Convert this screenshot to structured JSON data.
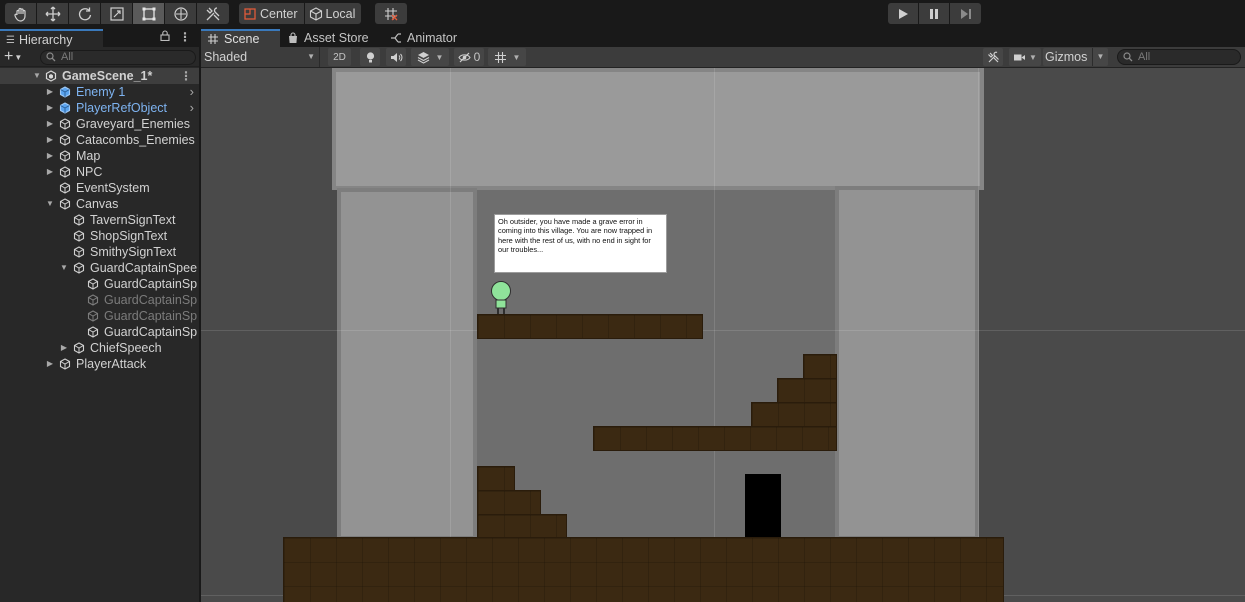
{
  "toolbar": {
    "tools": [
      {
        "name": "hand-tool",
        "icon": "hand-icon"
      },
      {
        "name": "move-tool",
        "icon": "move-arrows-icon"
      },
      {
        "name": "rotate-tool",
        "icon": "rotate-icon"
      },
      {
        "name": "scale-tool",
        "icon": "scale-icon"
      },
      {
        "name": "rect-tool",
        "icon": "rect-transform-icon",
        "active": true
      },
      {
        "name": "transform-tool",
        "icon": "transform-icon"
      },
      {
        "name": "custom-tool",
        "icon": "tools-icon"
      }
    ],
    "pivot_label": "Center",
    "pivot_rotation_label": "Local",
    "grid_snap_icon": "grid-snap-icon",
    "play_controls": [
      "play-icon",
      "pause-icon",
      "step-icon"
    ]
  },
  "hierarchy": {
    "tab_label": "Hierarchy",
    "search_placeholder": "All",
    "scene_name": "GameScene_1*",
    "items": [
      {
        "label": "Enemy 1",
        "depth": 1,
        "expand": "collapsed",
        "prefab": true,
        "chevron": true
      },
      {
        "label": "PlayerRefObject",
        "depth": 1,
        "expand": "collapsed",
        "prefab": true,
        "chevron": true
      },
      {
        "label": "Graveyard_Enemies",
        "depth": 1,
        "expand": "collapsed"
      },
      {
        "label": "Catacombs_Enemies",
        "depth": 1,
        "expand": "collapsed"
      },
      {
        "label": "Map",
        "depth": 1,
        "expand": "collapsed"
      },
      {
        "label": "NPC",
        "depth": 1,
        "expand": "collapsed"
      },
      {
        "label": "EventSystem",
        "depth": 1,
        "expand": "none"
      },
      {
        "label": "Canvas",
        "depth": 1,
        "expand": "expanded"
      },
      {
        "label": "TavernSignText",
        "depth": 2,
        "expand": "none"
      },
      {
        "label": "ShopSignText",
        "depth": 2,
        "expand": "none"
      },
      {
        "label": "SmithySignText",
        "depth": 2,
        "expand": "none"
      },
      {
        "label": "GuardCaptainSpee",
        "depth": 2,
        "expand": "expanded"
      },
      {
        "label": "GuardCaptainSp",
        "depth": 3,
        "expand": "none"
      },
      {
        "label": "GuardCaptainSp",
        "depth": 3,
        "expand": "none",
        "inactive": true
      },
      {
        "label": "GuardCaptainSp",
        "depth": 3,
        "expand": "none",
        "inactive": true
      },
      {
        "label": "GuardCaptainSp",
        "depth": 3,
        "expand": "none"
      },
      {
        "label": "ChiefSpeech",
        "depth": 2,
        "expand": "collapsed"
      },
      {
        "label": "PlayerAttack",
        "depth": 1,
        "expand": "collapsed"
      }
    ]
  },
  "scene_tabs": [
    {
      "label": "Scene",
      "icon": "grid-icon",
      "active": true
    },
    {
      "label": "Asset Store",
      "icon": "shopping-bag-icon"
    },
    {
      "label": "Animator",
      "icon": "animator-icon"
    }
  ],
  "scene_toolbar": {
    "shading_mode": "Shaded",
    "mode_2d_label": "2D",
    "hidden_count": "0",
    "gizmos_label": "Gizmos",
    "search_placeholder": "All"
  },
  "viewport": {
    "dialog_text": "Oh outsider, you have made a grave error in coming into this village. You are now trapped in here with the rest of us, with no end in sight for our troubles...",
    "player_color": "#8fe39a",
    "platform_color": "#3b2912",
    "wall_color": "#939393",
    "background_color": "#4a4a4a"
  },
  "colors": {
    "accent": "#3a79bb",
    "prefab_text": "#7eb3f0"
  }
}
